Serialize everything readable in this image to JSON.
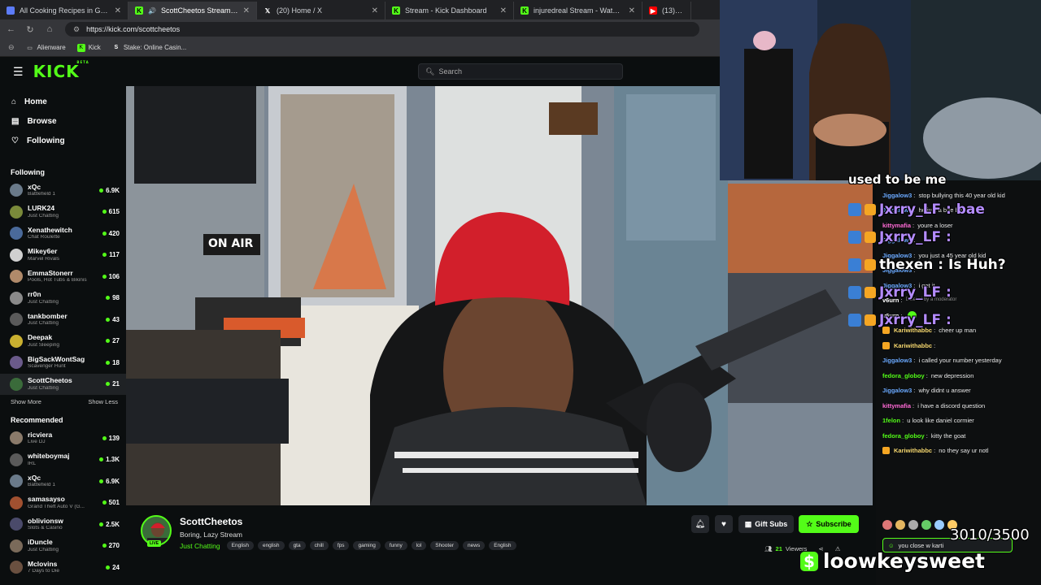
{
  "tabs": [
    {
      "label": "All Cooking Recipes in Grow A Garden",
      "icon": "cooking-site-icon",
      "color": "#5c7cfa",
      "active": false
    },
    {
      "label": "ScottCheetos Stream - Watch Live",
      "icon": "kick-icon",
      "color": "#53fc18",
      "active": true
    },
    {
      "label": "(20) Home / X",
      "icon": "x-icon",
      "color": "#ffffff",
      "active": false
    },
    {
      "label": "Stream - Kick Dashboard",
      "icon": "kick-icon",
      "color": "#53fc18",
      "active": false
    },
    {
      "label": "injuredreal Stream - Watch Live o...",
      "icon": "kick-icon",
      "color": "#53fc18",
      "active": false
    },
    {
      "label": "(13) Micha",
      "icon": "youtube-icon",
      "color": "#ff0000",
      "active": false
    }
  ],
  "address": {
    "url": "https://kick.com/scottcheetos"
  },
  "bookmarks": [
    {
      "label": "Alienware",
      "icon": "folder-icon"
    },
    {
      "label": "Kick",
      "icon": "kick-icon"
    },
    {
      "label": "Stake: Online Casin...",
      "icon": "stake-icon"
    }
  ],
  "site": {
    "logo": "KICK",
    "logo_sup": "BETA",
    "search_placeholder": "Search",
    "accent": "#53fc18"
  },
  "nav": [
    {
      "label": "Home",
      "icon": "home-icon"
    },
    {
      "label": "Browse",
      "icon": "browse-icon"
    },
    {
      "label": "Following",
      "icon": "heart-icon"
    }
  ],
  "following_title": "Following",
  "following": [
    {
      "name": "xQc",
      "category": "Battlefield 1",
      "viewers": "6.9K",
      "color": "#6a7a8a"
    },
    {
      "name": "LURK24",
      "category": "Just Chatting",
      "viewers": "615",
      "color": "#7a8a3a"
    },
    {
      "name": "Xenathewitch",
      "category": "Chat Roulette",
      "viewers": "420",
      "color": "#4a6a9a"
    },
    {
      "name": "Mikey6er",
      "category": "Marvel Rivals",
      "viewers": "117",
      "color": "#d0d0d0"
    },
    {
      "name": "EmmaStonerr",
      "category": "Pools, Hot Tubs & Bikinis",
      "viewers": "106",
      "color": "#b08a6a"
    },
    {
      "name": "rr0n",
      "category": "Just Chatting",
      "viewers": "98",
      "color": "#8a8a8a"
    },
    {
      "name": "tankbomber",
      "category": "Just Chatting",
      "viewers": "43",
      "color": "#5a5a5a"
    },
    {
      "name": "Deepak",
      "category": "Just Sleeping",
      "viewers": "27",
      "color": "#c9b030"
    },
    {
      "name": "BigSackWontSag",
      "category": "Scavenger Hunt",
      "viewers": "18",
      "color": "#6a5a8a"
    },
    {
      "name": "ScottCheetos",
      "category": "Just Chatting",
      "viewers": "21",
      "color": "#3a6b3a",
      "active": true
    }
  ],
  "show_more": "Show More",
  "show_less": "Show Less",
  "recommended_title": "Recommended",
  "recommended": [
    {
      "name": "ricviera",
      "category": "Live DJ",
      "viewers": "139",
      "color": "#8a7a6a"
    },
    {
      "name": "whiteboymaj",
      "category": "IRL",
      "viewers": "1.3K",
      "color": "#5a5a5a"
    },
    {
      "name": "xQc",
      "category": "Battlefield 1",
      "viewers": "6.9K",
      "color": "#6a7a8a"
    },
    {
      "name": "samasayso",
      "category": "Grand Theft Auto V (G...",
      "viewers": "501",
      "color": "#a05030"
    },
    {
      "name": "oblivionsw",
      "category": "Slots & Casino",
      "viewers": "2.5K",
      "color": "#4a4a6a"
    },
    {
      "name": "iDuncle",
      "category": "Just Chatting",
      "viewers": "270",
      "color": "#7a6a5a"
    },
    {
      "name": "Mclovins",
      "category": "7 Days to Die",
      "viewers": "24",
      "color": "#6a5040"
    }
  ],
  "video": {
    "sign": "ON AIR"
  },
  "streamer": {
    "name": "ScottCheetos",
    "title": "Boring, Lazy Stream",
    "category": "Just Chatting",
    "live_label": "LIVE",
    "tags": [
      "English",
      "english",
      "gta",
      "chill",
      "fps",
      "gaming",
      "funny",
      "lol",
      "Shooter",
      "news",
      "English"
    ],
    "gift_subs": "Gift Subs",
    "subscribe": "Subscribe",
    "viewers": "21",
    "viewers_label": "Viewers"
  },
  "chat": {
    "messages": [
      {
        "user": "Jiggalow3",
        "text": "stop bullying this 40 year old kid",
        "color": "#6aa9ff"
      },
      {
        "user": "Jiggalow3",
        "text": "he just a bae bee",
        "color": "#6aa9ff"
      },
      {
        "user": "kittymafia",
        "text": "youre a loser",
        "color": "#ff6ad5"
      },
      {
        "user": "Jiggalow3",
        "text": "",
        "color": "#6aa9ff"
      },
      {
        "user": "Jiggalow3",
        "text": "you just a 45 year old kid",
        "color": "#6aa9ff"
      },
      {
        "user": "Jiggalow3",
        "text": "",
        "color": "#6aa9ff"
      },
      {
        "user": "Jiggalow3",
        "text": "i get it",
        "color": "#6aa9ff"
      },
      {
        "user": "v6urn",
        "text": "Deleted by a moderator",
        "color": "#ffffff",
        "deleted": true
      },
      {
        "user": "v6urn",
        "text": "",
        "color": "#ffffff",
        "emote": true
      },
      {
        "user": "Kariwithabbc",
        "text": "cheer up man",
        "color": "#f5d76e",
        "badge": true
      },
      {
        "user": "Kariwithabbc",
        "text": "",
        "color": "#f5d76e",
        "badge": true
      },
      {
        "user": "Jiggalow3",
        "text": "i called your number yesterday",
        "color": "#6aa9ff"
      },
      {
        "user": "fedora_globoy",
        "text": "new depression",
        "color": "#53fc18"
      },
      {
        "user": "Jiggalow3",
        "text": "why didnt u answer",
        "color": "#6aa9ff"
      },
      {
        "user": "kittymafia",
        "text": "i have a discord question",
        "color": "#ff6ad5"
      },
      {
        "user": "1felon",
        "text": "u look like daniel cormier",
        "color": "#53fc18"
      },
      {
        "user": "fedora_globoy",
        "text": "kitty the goat",
        "color": "#53fc18"
      },
      {
        "user": "Kariwithabbc",
        "text": "no they say ur notl",
        "color": "#f5d76e",
        "badge": true
      }
    ],
    "input_value": "you close w karti"
  },
  "overlay": {
    "header_text": "used to be me",
    "alerts": [
      "Jxrry_LF : bae",
      "Jxrry_LF :",
      "thexen : Is Huh?",
      "Jxrry_LF :",
      "Jxrry_LF :"
    ],
    "goal": "3010/3500",
    "name": "loowkeysweet"
  }
}
